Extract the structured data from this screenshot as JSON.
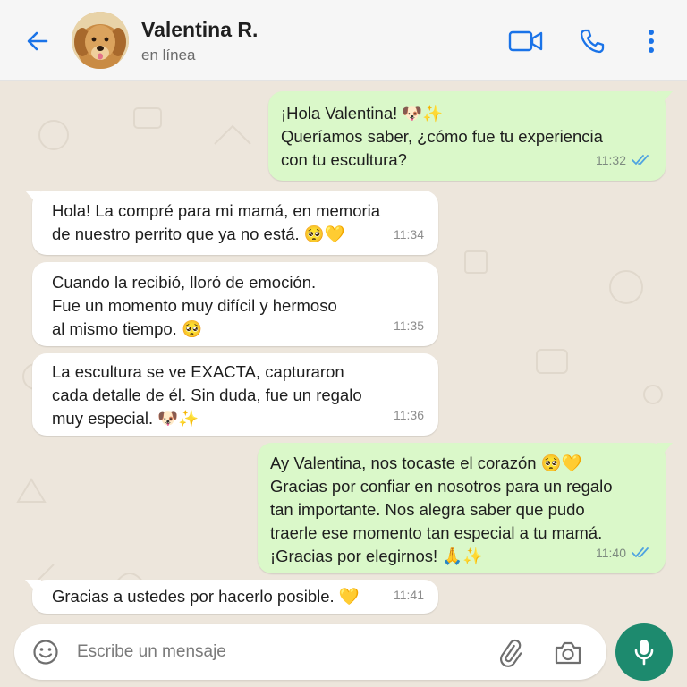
{
  "header": {
    "contact_name": "Valentina R.",
    "status": "en línea",
    "icons": [
      "back-arrow-icon",
      "video-call-icon",
      "phone-icon",
      "more-vertical-icon"
    ],
    "accent_color": "#1a73e8"
  },
  "messages": [
    {
      "direction": "out",
      "text": "¡Hola Valentina! 🐶✨\nQueríamos saber, ¿cómo fue tu experiencia\ncon tu escultura?",
      "time": "11:32",
      "status": "read"
    },
    {
      "direction": "in",
      "text": "Hola! La compré para mi mamá, en memoria\nde nuestro perrito que ya no está. 🥺💛",
      "time": "11:34"
    },
    {
      "direction": "in",
      "text": "Cuando la recibió, lloró de emoción.\nFue un momento muy difícil y hermoso\nal mismo tiempo. 🥺",
      "time": "11:35"
    },
    {
      "direction": "in",
      "text": "La escultura se ve EXACTA, capturaron\ncada detalle de él. Sin duda, fue un regalo\nmuy especial. 🐶✨",
      "time": "11:36"
    },
    {
      "direction": "out",
      "text": "Ay Valentina, nos tocaste el corazón 🥺💛\nGracias por confiar en nosotros para un regalo\ntan importante. Nos alegra saber que pudo\ntraerle ese momento tan especial a tu mamá.\n¡Gracias por elegirnos! 🙏✨",
      "time": "11:40",
      "status": "read"
    },
    {
      "direction": "in",
      "text": "Gracias a ustedes por hacerlo posible. 💛",
      "time": "11:41"
    }
  ],
  "composer": {
    "placeholder": "Escribe un mensaje",
    "icons": [
      "emoji-icon",
      "attach-icon",
      "camera-icon",
      "mic-icon"
    ],
    "mic_color": "#1d8a6e"
  },
  "colors": {
    "outgoing_bubble": "#daf8c9",
    "incoming_bubble": "#ffffff",
    "chat_background": "#ede6dc",
    "read_ticks": "#4fa3e0"
  }
}
